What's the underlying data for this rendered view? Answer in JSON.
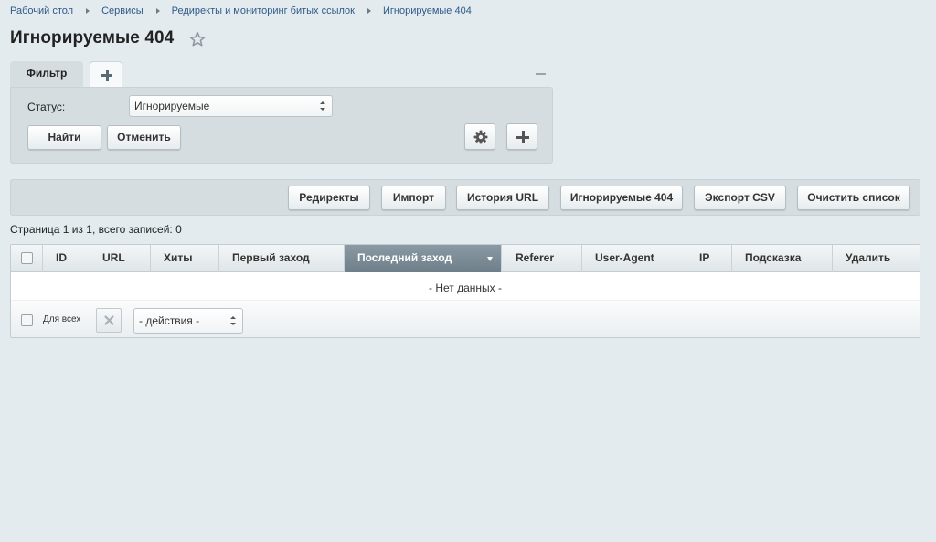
{
  "breadcrumb": [
    "Рабочий стол",
    "Сервисы",
    "Редиректы и мониторинг битых ссылок",
    "Игнорируемые 404"
  ],
  "page_title": "Игнорируемые 404",
  "filter": {
    "tab_label": "Фильтр",
    "status_label": "Статус:",
    "status_value": "Игнорируемые",
    "find_button": "Найти",
    "cancel_button": "Отменить"
  },
  "toolbar": {
    "buttons": [
      "Редиректы",
      "Импорт",
      "История URL",
      "Игнорируемые 404",
      "Экспорт CSV",
      "Очистить список"
    ]
  },
  "page_info": "Страница 1 из 1, всего записей: 0",
  "grid": {
    "columns": [
      "ID",
      "URL",
      "Хиты",
      "Первый заход",
      "Последний заход",
      "Referer",
      "User-Agent",
      "IP",
      "Подсказка",
      "Удалить"
    ],
    "sorted_column": "Последний заход",
    "empty_text": "- Нет данных -",
    "for_all_label": "Для всех",
    "actions_value": "- действия -"
  }
}
